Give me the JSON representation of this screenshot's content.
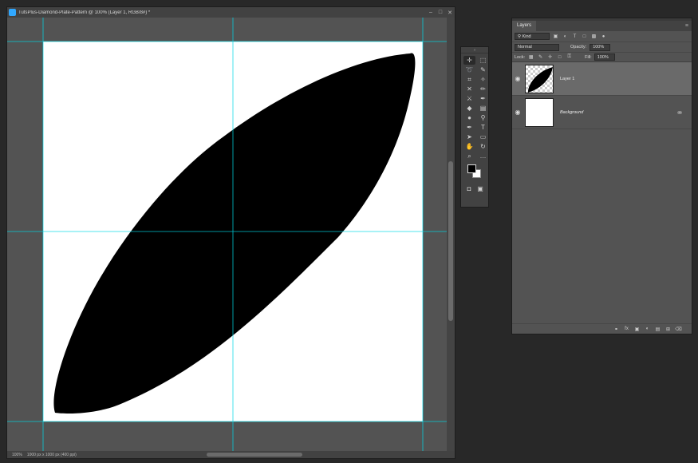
{
  "document": {
    "title": "TutsPlus-Diamond-Plate-Pattern @ 100% (Layer 1, RGB/8#) *",
    "zoom": "100%",
    "doc_info": "1000 px x 1000 px (400 ppi)",
    "window_buttons": [
      "–",
      "□",
      "✕"
    ]
  },
  "toolbar": {
    "grip": "»",
    "tools": [
      {
        "name": "move-tool",
        "glyph": "✛"
      },
      {
        "name": "marquee-tool",
        "glyph": "⬚"
      },
      {
        "name": "lasso-tool",
        "glyph": "➰"
      },
      {
        "name": "quick-select-tool",
        "glyph": "✎"
      },
      {
        "name": "crop-tool",
        "glyph": "⌗"
      },
      {
        "name": "eyedropper-tool",
        "glyph": "✧"
      },
      {
        "name": "healing-brush-tool",
        "glyph": "✕"
      },
      {
        "name": "brush-tool",
        "glyph": "✏"
      },
      {
        "name": "clone-stamp-tool",
        "glyph": "⚔"
      },
      {
        "name": "history-brush-tool",
        "glyph": "✒"
      },
      {
        "name": "eraser-tool",
        "glyph": "◆"
      },
      {
        "name": "gradient-tool",
        "glyph": "▤"
      },
      {
        "name": "blur-tool",
        "glyph": "●"
      },
      {
        "name": "dodge-tool",
        "glyph": "⚲"
      },
      {
        "name": "pen-tool",
        "glyph": "✒"
      },
      {
        "name": "type-tool",
        "glyph": "T"
      },
      {
        "name": "path-select-tool",
        "glyph": "➤"
      },
      {
        "name": "shape-tool",
        "glyph": "▭"
      },
      {
        "name": "hand-tool",
        "glyph": "✋"
      },
      {
        "name": "rotate-view-tool",
        "glyph": "↻"
      },
      {
        "name": "zoom-tool",
        "glyph": "⌕"
      },
      {
        "name": "more-tools",
        "glyph": "…"
      }
    ],
    "quick_mask_glyph": "◘",
    "screen_mode_glyph": "▣"
  },
  "layers_panel": {
    "tab_label": "Layers",
    "menu_glyph": "≡",
    "filter_kind": "Kind",
    "blend_mode": "Normal",
    "opacity_label": "Opacity:",
    "opacity_value": "100%",
    "lock_label": "Lock:",
    "fill_label": "Fill:",
    "fill_value": "100%",
    "layers": [
      {
        "name": "Layer 1",
        "selected": true
      },
      {
        "name": "Background",
        "selected": false,
        "locked": true
      }
    ],
    "footer_icons": [
      "link-icon",
      "fx-icon",
      "mask-icon",
      "adjustment-icon",
      "folder-icon",
      "new-layer-icon",
      "trash-icon"
    ]
  }
}
